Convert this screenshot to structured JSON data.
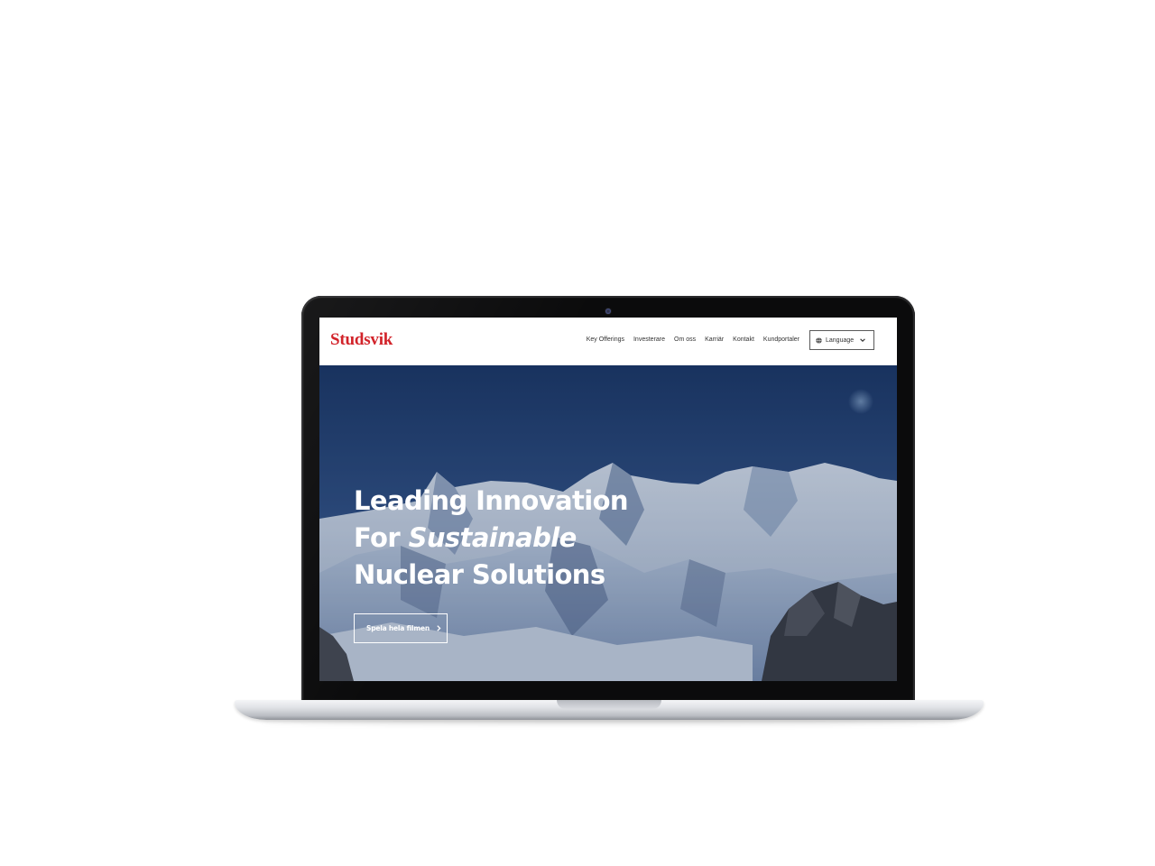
{
  "header": {
    "logo_text": "Studsvik",
    "nav_items": [
      {
        "label": "Key Offerings"
      },
      {
        "label": "Investerare"
      },
      {
        "label": "Om oss"
      },
      {
        "label": "Karriär"
      },
      {
        "label": "Kontakt"
      },
      {
        "label": "Kundportaler"
      }
    ],
    "language_label": "Language",
    "language_icon": "globe-icon",
    "dropdown_icon": "chevron-down-icon"
  },
  "hero": {
    "title_line1": "Leading Innovation",
    "title_line2_prefix": "For ",
    "title_line2_emphasis": "Sustainable",
    "title_line3": "Nuclear Solutions",
    "cta_label": "Spela hela filmen",
    "cta_icon": "chevron-right-icon"
  },
  "colors": {
    "brand_red": "#d2232a",
    "sky": "#1f3a6b",
    "white": "#ffffff"
  }
}
